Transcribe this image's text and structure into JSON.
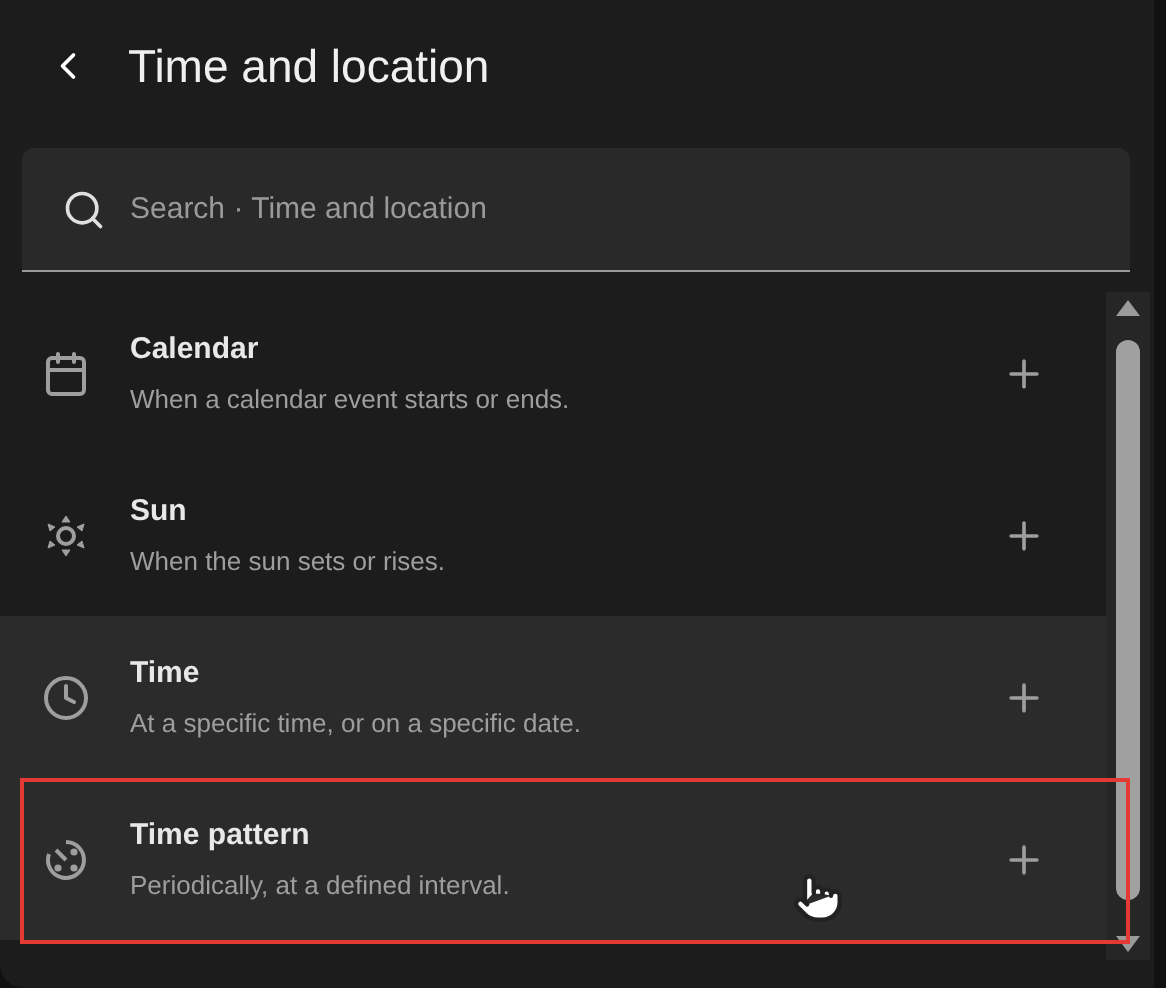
{
  "header": {
    "title": "Time and location"
  },
  "search": {
    "placeholder": "Search · Time and location"
  },
  "items": [
    {
      "kind": "calendar",
      "title": "Calendar",
      "description": "When a calendar event starts or ends.",
      "highlighted": false,
      "outlined": false
    },
    {
      "kind": "sun",
      "title": "Sun",
      "description": "When the sun sets or rises.",
      "highlighted": false,
      "outlined": false
    },
    {
      "kind": "time",
      "title": "Time",
      "description": "At a specific time, or on a specific date.",
      "highlighted": true,
      "outlined": false
    },
    {
      "kind": "pattern",
      "title": "Time pattern",
      "description": "Periodically, at a defined interval.",
      "highlighted": true,
      "outlined": true
    }
  ]
}
